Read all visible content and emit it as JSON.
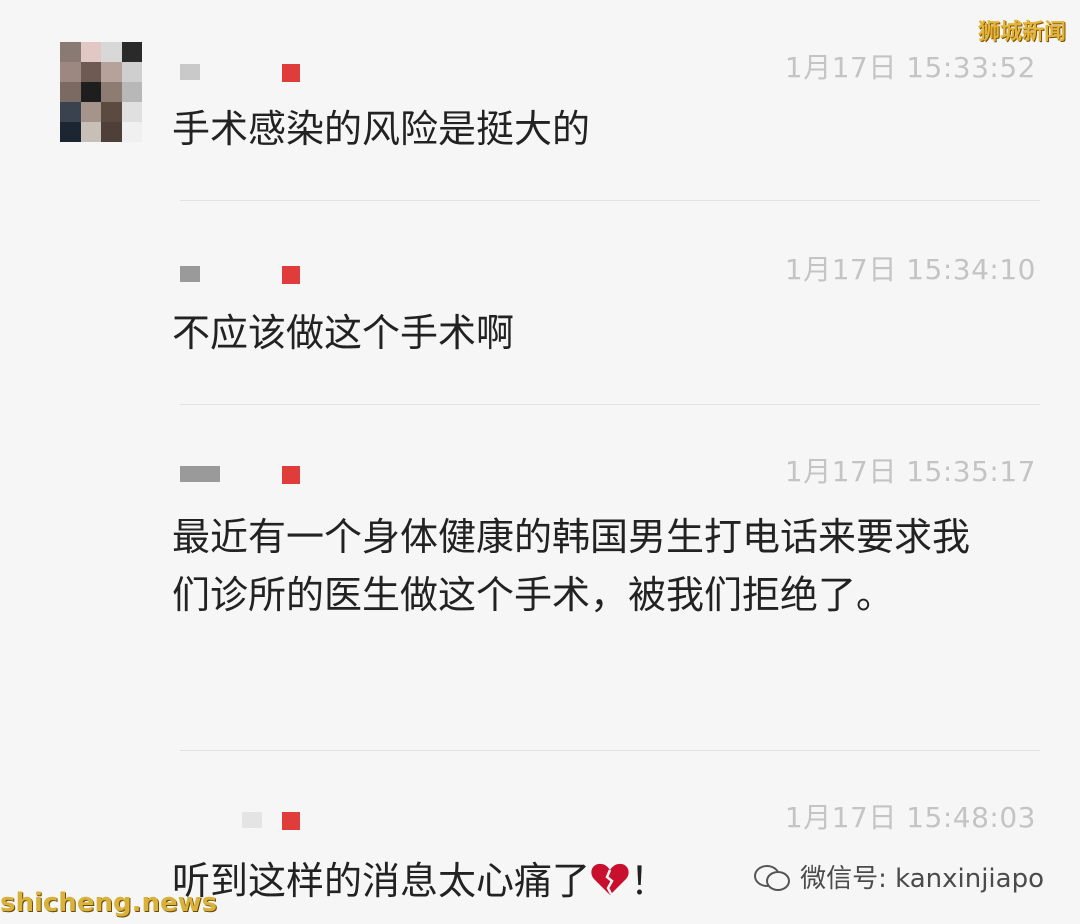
{
  "watermarks": {
    "top_right": "狮城新闻",
    "bottom_left": "shicheng.news",
    "wechat_id": "微信号: kanxinjiapo"
  },
  "messages": [
    {
      "time": "1月17日 15:33:52",
      "text": "手术感染的风险是挺大的"
    },
    {
      "time": "1月17日 15:34:10",
      "text": "不应该做这个手术啊"
    },
    {
      "time": "1月17日 15:35:17",
      "text": "最近有一个身体健康的韩国男生打电话来要求我们诊所的医生做这个手术，被我们拒绝了。"
    },
    {
      "time": "1月17日 15:48:03",
      "text": "听到这样的消息太心痛了",
      "trailing_emoji": "broken-heart-icon",
      "trailing_text": "！"
    }
  ]
}
